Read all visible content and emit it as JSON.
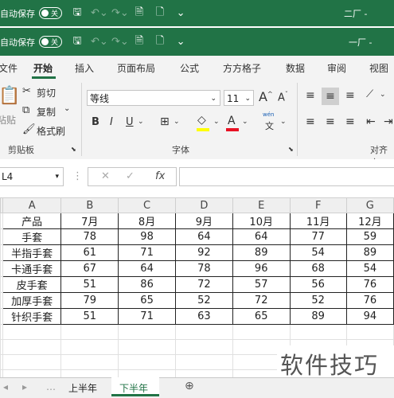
{
  "qat": {
    "autosave_label_top": "自动保存",
    "autosave_label": "自动保存",
    "toggle_state": "关",
    "right_text_top": "二厂 -",
    "right_text": "一厂 -"
  },
  "tabs": [
    "文件",
    "开始",
    "插入",
    "页面布局",
    "公式",
    "方方格子",
    "数据",
    "审阅",
    "视图"
  ],
  "ribbon": {
    "paste_label": "粘贴",
    "cut": "剪切",
    "copy": "复制",
    "format_painter": "格式刷",
    "clipboard_group": "剪贴板",
    "font_name": "等线",
    "font_size": "11",
    "font_group": "字体",
    "align_group": "对齐方",
    "bold": "B",
    "italic": "I",
    "underline": "U",
    "wen": "wén",
    "wen_char": "文",
    "grow_font": "A",
    "shrink_font": "A"
  },
  "formula_bar": {
    "name_box": "L4",
    "fx": "fx",
    "cancel": "✕",
    "enter": "✓",
    "value": ""
  },
  "columns": [
    "",
    "A",
    "B",
    "C",
    "D",
    "E",
    "F",
    "G"
  ],
  "rows": [
    [
      "产品",
      "7月",
      "8月",
      "9月",
      "10月",
      "11月",
      "12月"
    ],
    [
      "手套",
      "78",
      "98",
      "64",
      "64",
      "77",
      "59"
    ],
    [
      "半指手套",
      "61",
      "71",
      "92",
      "89",
      "54",
      "89"
    ],
    [
      "卡通手套",
      "67",
      "64",
      "78",
      "96",
      "68",
      "54"
    ],
    [
      "皮手套",
      "51",
      "86",
      "72",
      "57",
      "56",
      "76"
    ],
    [
      "加厚手套",
      "79",
      "65",
      "52",
      "72",
      "52",
      "76"
    ],
    [
      "针织手套",
      "51",
      "71",
      "63",
      "65",
      "89",
      "94"
    ]
  ],
  "sheets": [
    "上半年",
    "下半年"
  ],
  "active_sheet": "下半年",
  "watermark": "软件技巧",
  "colors": {
    "brand": "#217346",
    "ribbon_bg": "#f3f3f3"
  }
}
